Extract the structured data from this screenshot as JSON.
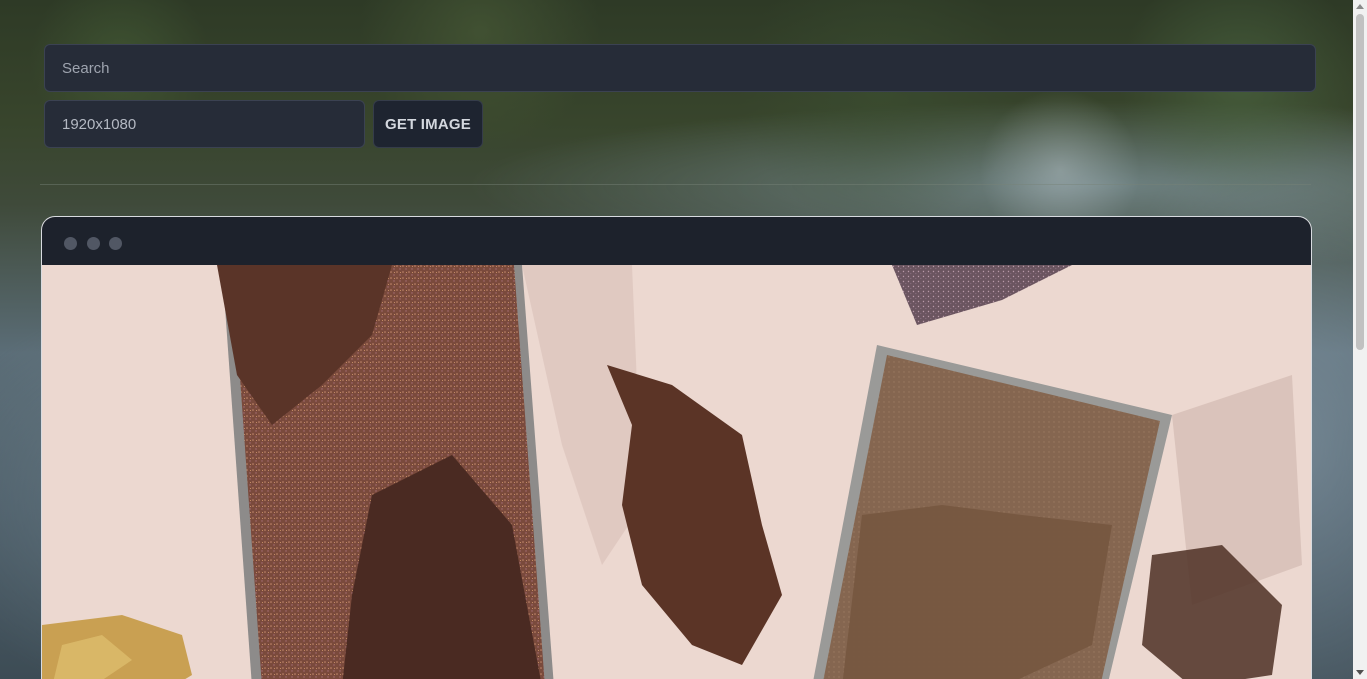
{
  "search": {
    "placeholder": "Search"
  },
  "size": {
    "value": "1920x1080"
  },
  "get_image": {
    "label": "GET IMAGE"
  },
  "preview": {
    "dots": [
      "window-dot",
      "window-dot",
      "window-dot"
    ]
  },
  "colors": {
    "input_bg": "#262c38",
    "titlebar_bg": "#1d222c",
    "dot": "#515764",
    "photo_bg": "#f0dcd6",
    "shimmer_eyeshadow": "#7a4a3c",
    "matte_eyeshadow": "#8a6a50",
    "crumbles": "#4a2a20",
    "gold_glitter": "#c8a050"
  }
}
